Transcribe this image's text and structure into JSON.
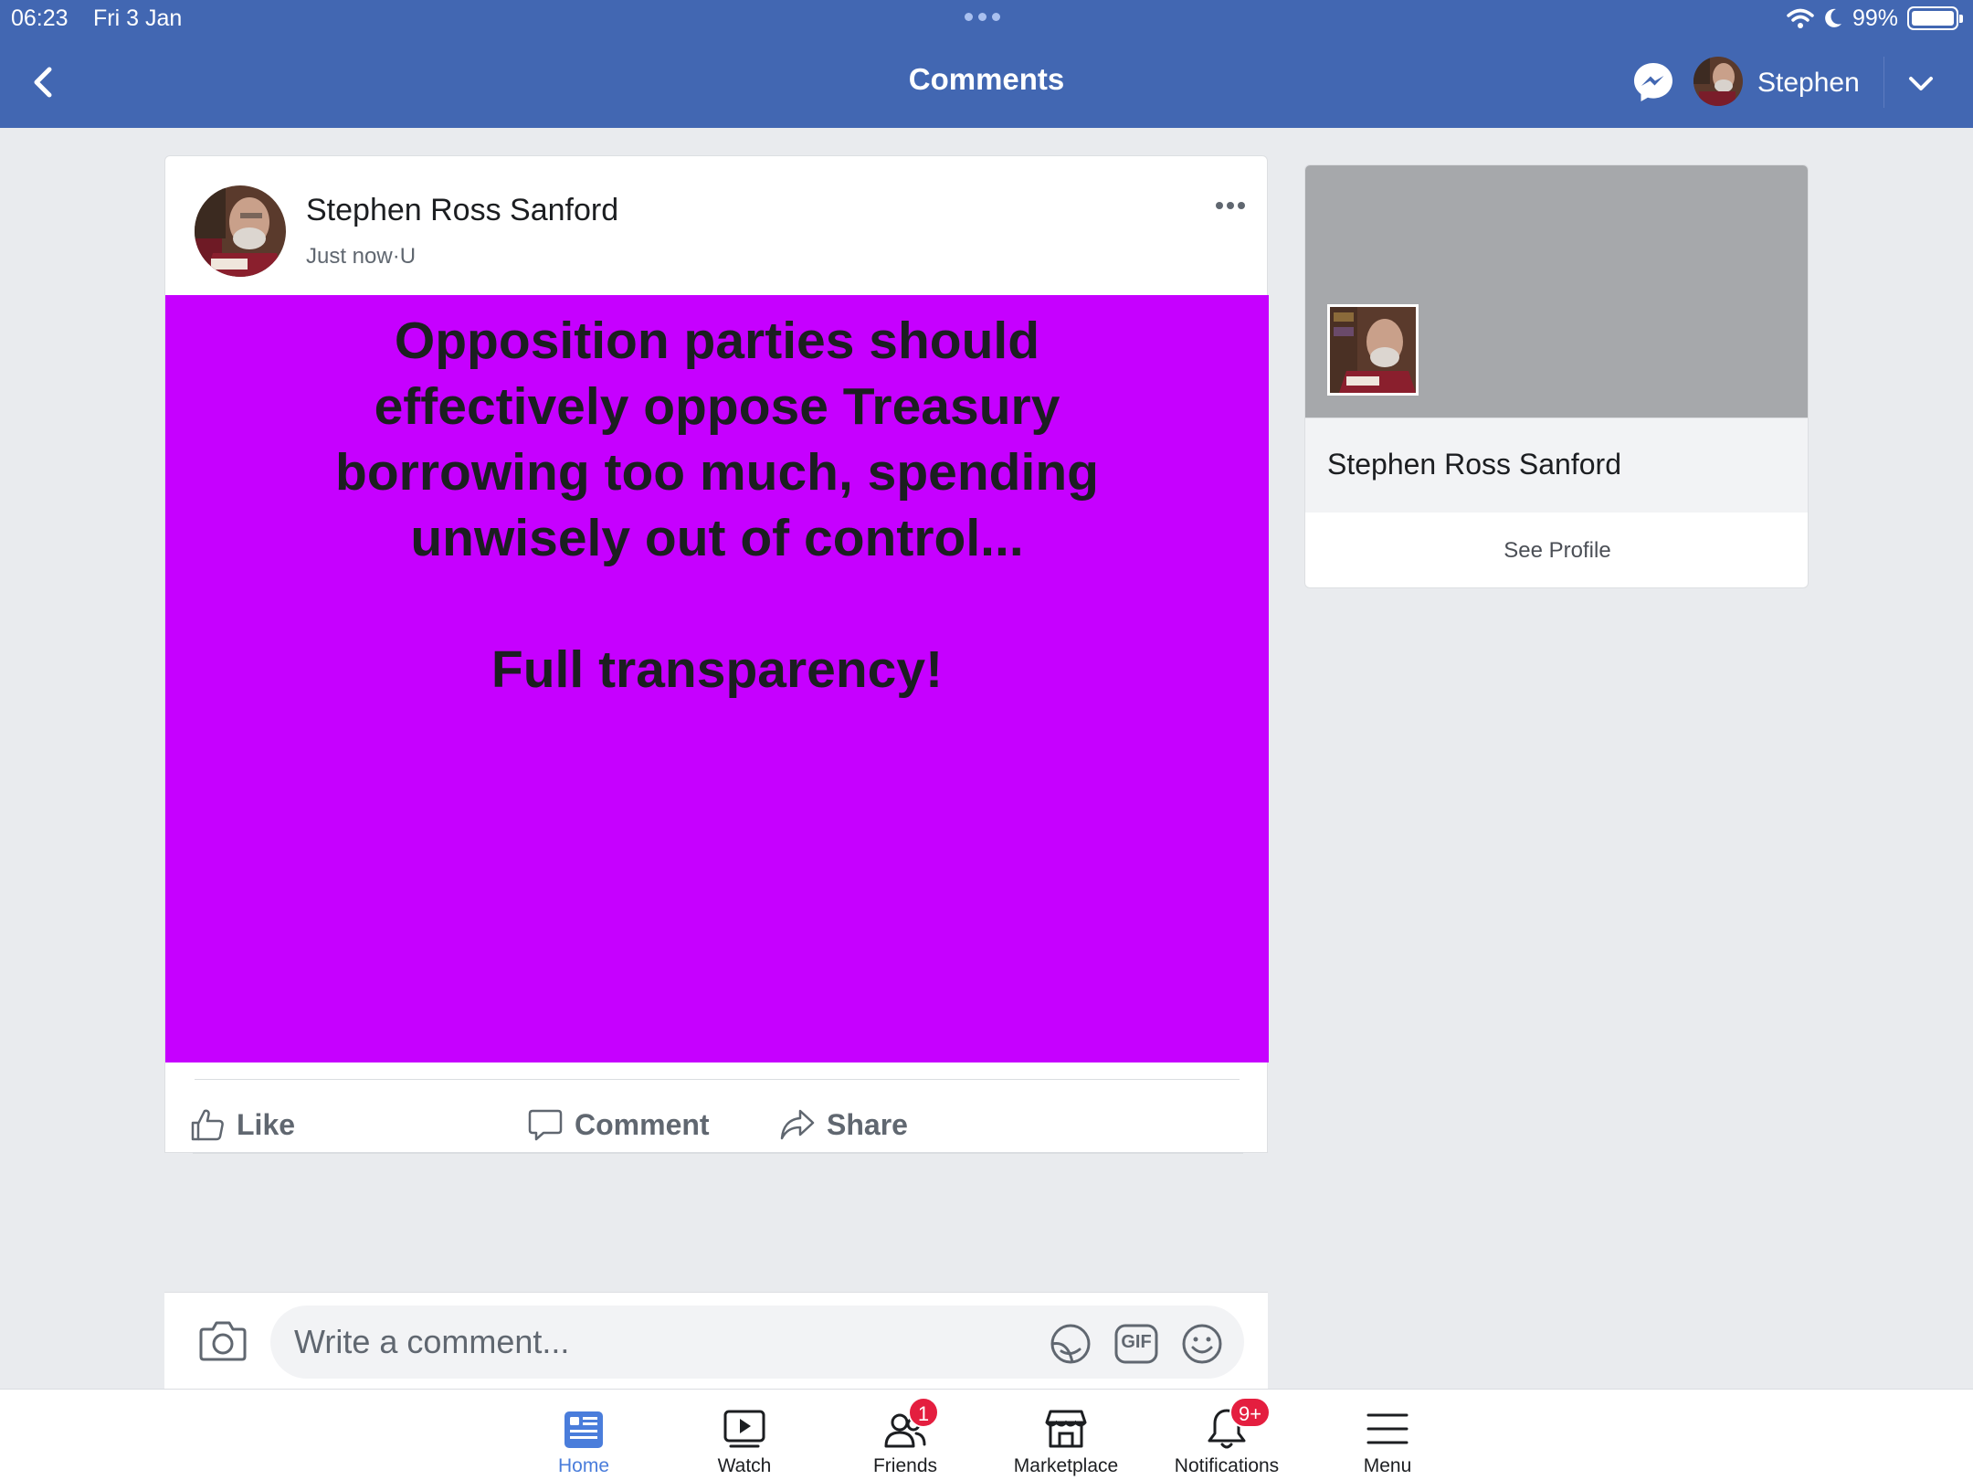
{
  "status_bar": {
    "time": "06:23",
    "date": "Fri 3 Jan",
    "battery": "99%",
    "battery_level": 0.99
  },
  "header": {
    "title": "Comments",
    "user_name": "Stephen",
    "icons": [
      "back-chevron-icon",
      "messenger-icon",
      "dropdown-chevron-icon"
    ],
    "background_color": "#4267b2"
  },
  "post": {
    "author": "Stephen Ross Sanford",
    "time": "Just now",
    "separator": "·",
    "audience": "U",
    "text": "Opposition parties should\neffectively oppose Treasury\nborrowing too much, spending\nunwisely out of control...\n\nFull transparency!",
    "background_color": "#c600ff",
    "actions": {
      "like": "Like",
      "comment": "Comment",
      "share": "Share"
    }
  },
  "profile_card": {
    "name": "Stephen Ross Sanford",
    "see_profile": "See Profile"
  },
  "composer": {
    "placeholder": "Write a comment...",
    "icons": [
      "camera-icon",
      "sticker-icon",
      "gif-icon",
      "emoji-icon"
    ],
    "gif_label": "GIF"
  },
  "tabbar": {
    "tabs": [
      {
        "label": "Home",
        "icon": "home-feed-icon",
        "active": true
      },
      {
        "label": "Watch",
        "icon": "watch-icon"
      },
      {
        "label": "Friends",
        "icon": "friends-icon",
        "badge": "1"
      },
      {
        "label": "Marketplace",
        "icon": "marketplace-icon"
      },
      {
        "label": "Notifications",
        "icon": "bell-icon",
        "badge": "9+"
      },
      {
        "label": "Menu",
        "icon": "menu-icon"
      }
    ],
    "active_color": "#4a7ddb",
    "badge_color": "#e41e3f"
  }
}
